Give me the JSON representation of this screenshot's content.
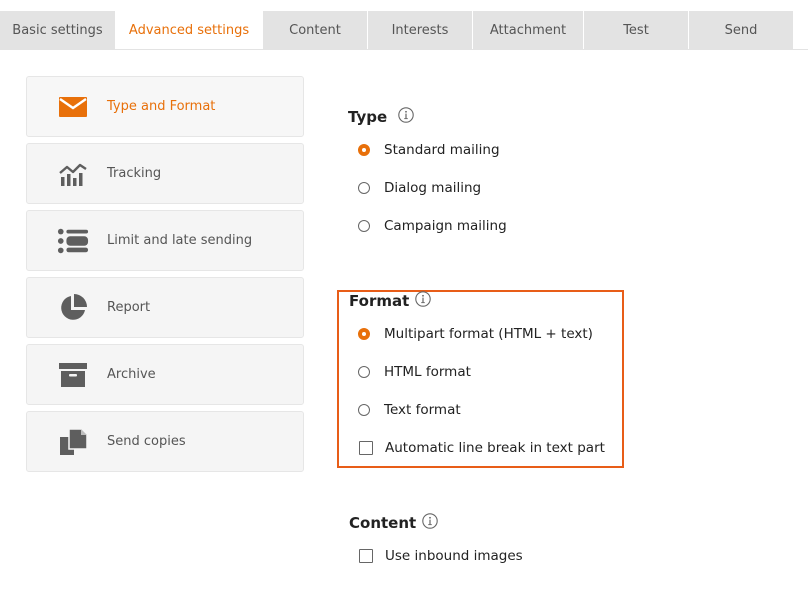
{
  "tabs": [
    {
      "label": "Basic settings",
      "active": false
    },
    {
      "label": "Advanced settings",
      "active": true
    },
    {
      "label": "Content",
      "active": false
    },
    {
      "label": "Interests",
      "active": false
    },
    {
      "label": "Attachment",
      "active": false
    },
    {
      "label": "Test",
      "active": false
    },
    {
      "label": "Send",
      "active": false
    }
  ],
  "sidebar": {
    "items": [
      {
        "label": "Type and Format",
        "icon": "envelope-icon",
        "active": true
      },
      {
        "label": "Tracking",
        "icon": "chart-icon",
        "active": false
      },
      {
        "label": "Limit and late sending",
        "icon": "list-toggle-icon",
        "active": false
      },
      {
        "label": "Report",
        "icon": "pie-chart-icon",
        "active": false
      },
      {
        "label": "Archive",
        "icon": "archive-icon",
        "active": false
      },
      {
        "label": "Send copies",
        "icon": "copy-icon",
        "active": false
      }
    ]
  },
  "type_section": {
    "title": "Type",
    "options": [
      {
        "label": "Standard mailing",
        "checked": true
      },
      {
        "label": "Dialog mailing",
        "checked": false
      },
      {
        "label": "Campaign mailing",
        "checked": false
      }
    ]
  },
  "format_section": {
    "title": "Format",
    "options": [
      {
        "label": "Multipart format (HTML + text)",
        "checked": true
      },
      {
        "label": "HTML format",
        "checked": false
      },
      {
        "label": "Text format",
        "checked": false
      }
    ],
    "checkbox": {
      "label": "Automatic line break in text part",
      "checked": false
    }
  },
  "content_section": {
    "title": "Content",
    "checkbox": {
      "label": "Use inbound images",
      "checked": false
    }
  },
  "colors": {
    "accent": "#e8700a",
    "highlight": "#e85d18",
    "icon_gray": "#5e5e5e"
  }
}
